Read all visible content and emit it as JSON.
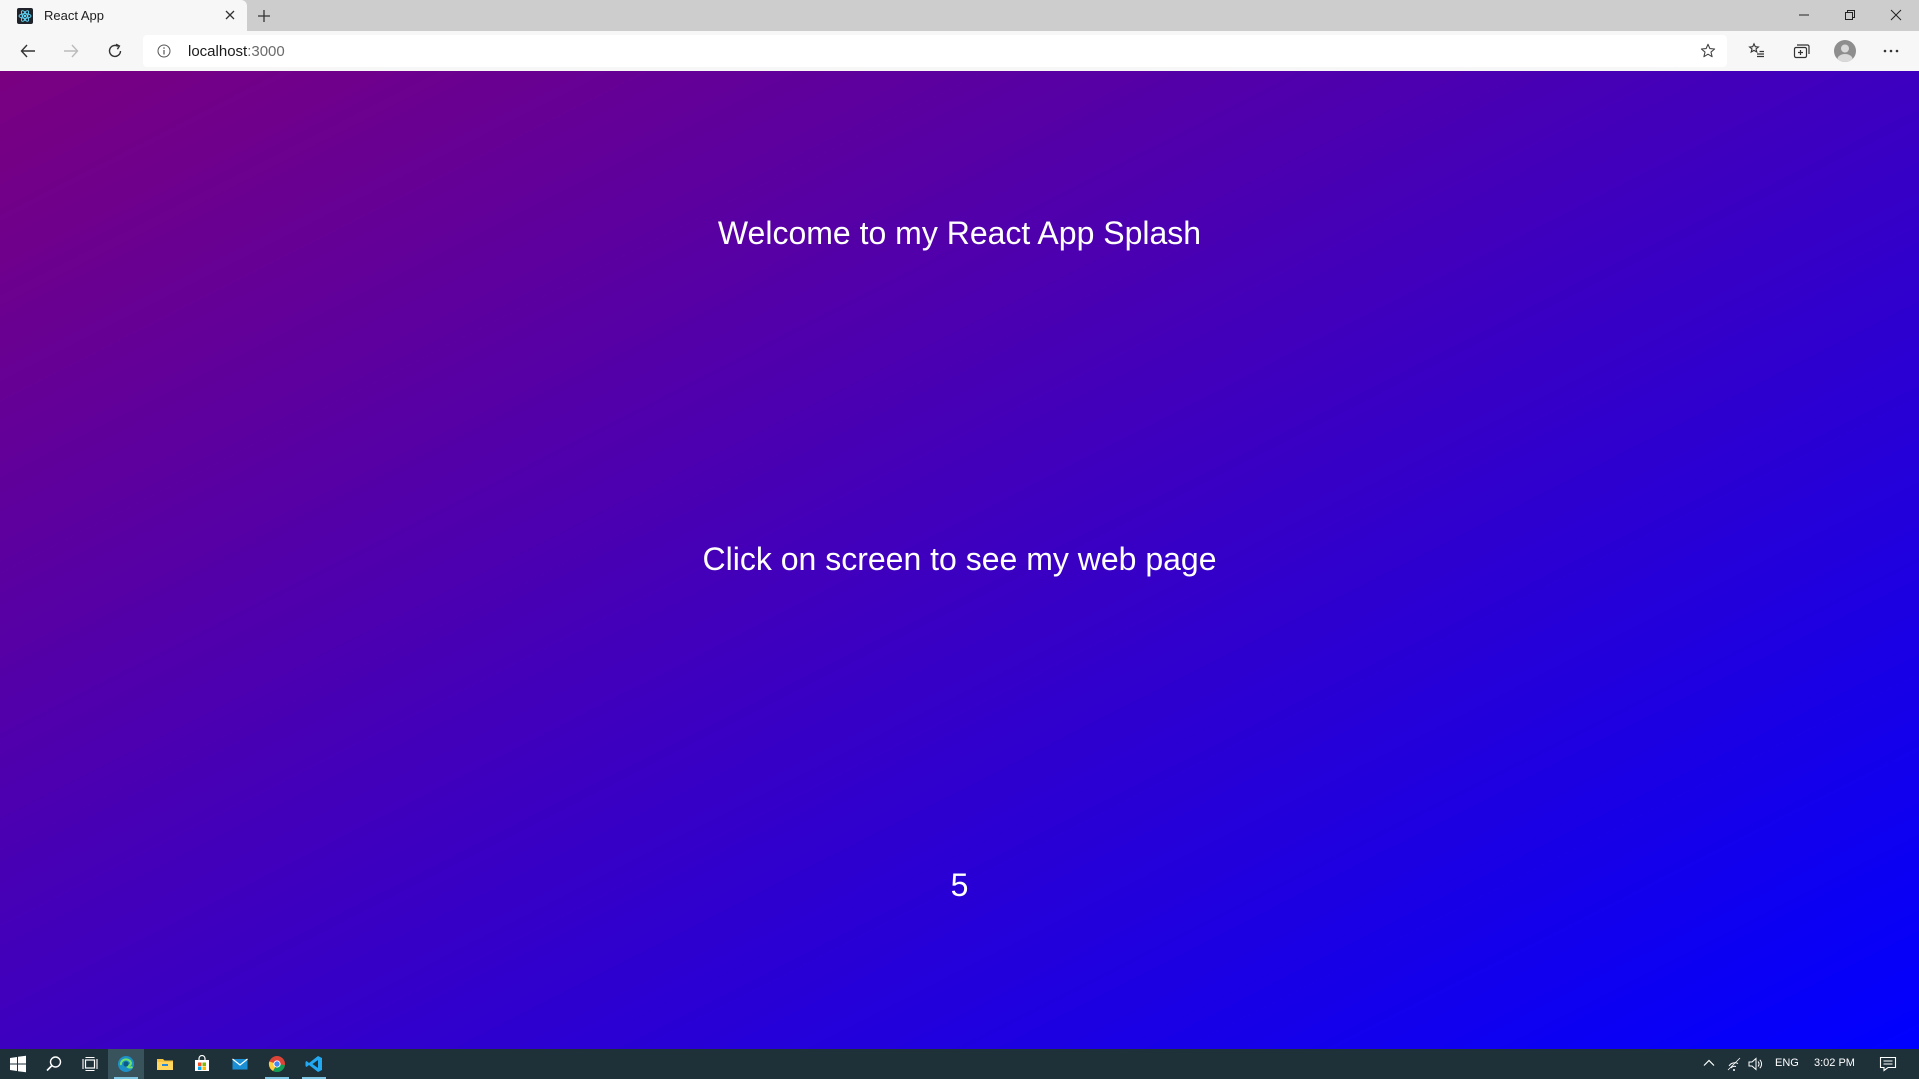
{
  "browser": {
    "tab_title": "React App",
    "address": {
      "host": "localhost",
      "port": ":3000"
    }
  },
  "page": {
    "background_gradient": [
      "#7a0080",
      "#0000ff"
    ],
    "text_color": "#ffffff",
    "welcome_text": "Welcome to my React App Splash",
    "click_text": "Click on screen to see my web page",
    "countdown": "5"
  },
  "taskbar": {
    "apps": [
      "start-icon",
      "search-icon",
      "task-view-icon",
      "edge-icon",
      "file-explorer-icon",
      "store-icon",
      "mail-icon",
      "chrome-icon",
      "vscode-icon"
    ],
    "language": "ENG",
    "time": "3:02 PM"
  }
}
